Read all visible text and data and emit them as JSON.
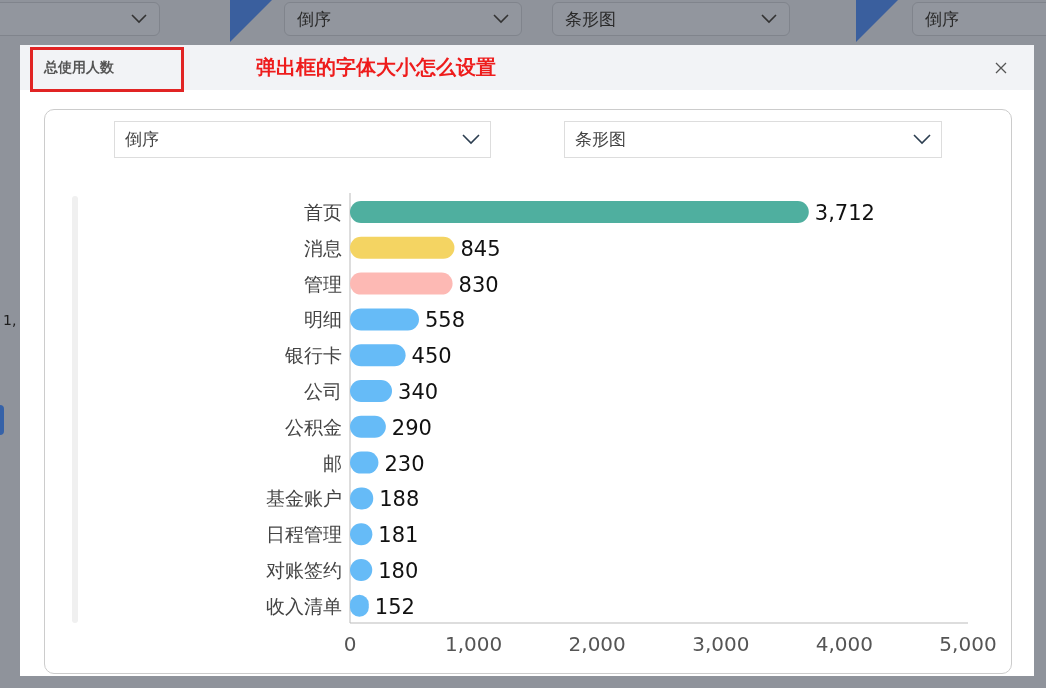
{
  "background": {
    "selects": [
      {
        "value": "倒序"
      },
      {
        "value": "条形图"
      },
      {
        "value": "倒序"
      }
    ],
    "axis_fragment": "1,"
  },
  "dialog": {
    "title": "总使用人数",
    "annotation": "弹出框的字体大小怎么设置",
    "controls": [
      {
        "value": "倒序"
      },
      {
        "value": "条形图"
      }
    ],
    "chart_data": {
      "type": "bar",
      "orientation": "horizontal",
      "categories": [
        "首页",
        "消息",
        "管理",
        "明细",
        "银行卡",
        "公司",
        "公积金",
        "邮",
        "基金账户",
        "日程管理",
        "对账签约",
        "收入清单"
      ],
      "series": [
        {
          "color": "#4faf9f",
          "values": [
            3712,
            null,
            null,
            null,
            null,
            null,
            null,
            null,
            null,
            null,
            null,
            null
          ]
        },
        {
          "color": "#f4d462",
          "values": [
            null,
            845,
            null,
            null,
            null,
            null,
            null,
            null,
            null,
            null,
            null,
            null
          ]
        },
        {
          "color": "#fdb9b4",
          "values": [
            null,
            null,
            830,
            null,
            null,
            null,
            null,
            null,
            null,
            null,
            null,
            null
          ]
        },
        {
          "color": "#66bbf7",
          "values": [
            null,
            null,
            null,
            558,
            450,
            340,
            290,
            230,
            188,
            181,
            180,
            152
          ]
        }
      ],
      "value_labels": [
        "3,712",
        "845",
        "830",
        "558",
        "450",
        "340",
        "290",
        "230",
        "188",
        "181",
        "180",
        "152"
      ],
      "xlim": [
        0,
        5000
      ],
      "xticks": [
        {
          "value": 0,
          "label": "0"
        },
        {
          "value": 1000,
          "label": "1,000"
        },
        {
          "value": 2000,
          "label": "2,000"
        },
        {
          "value": 3000,
          "label": "3,000"
        },
        {
          "value": 4000,
          "label": "4,000"
        },
        {
          "value": 5000,
          "label": "5,000"
        }
      ]
    }
  }
}
